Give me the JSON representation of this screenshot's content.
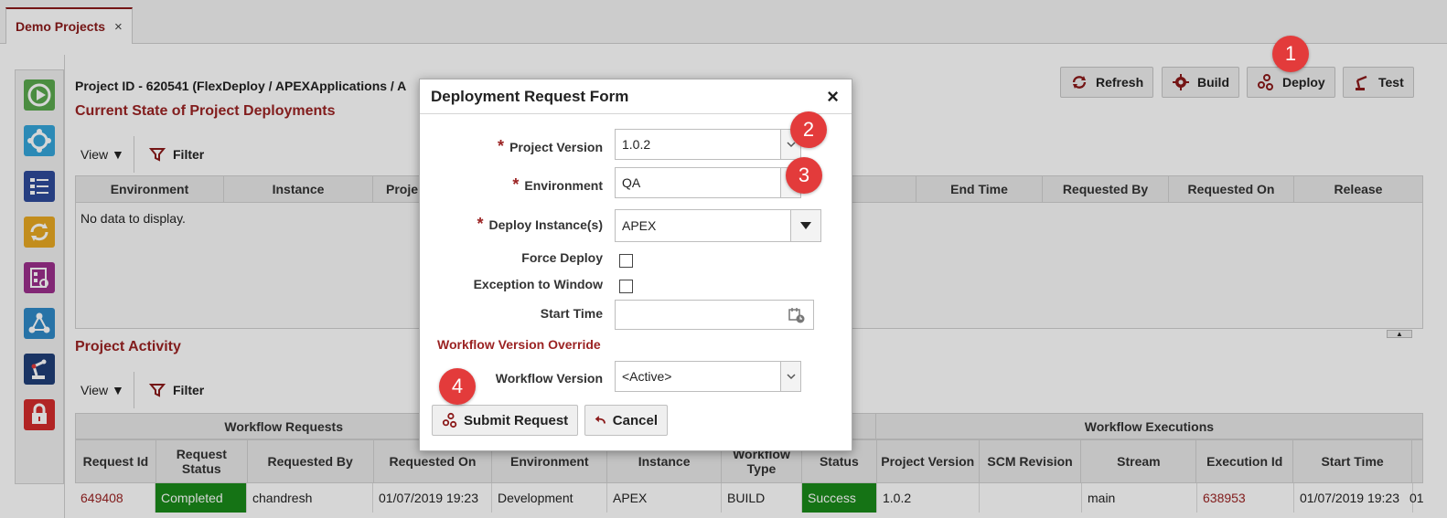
{
  "tab": {
    "title": "Demo Projects",
    "close": "×"
  },
  "project": {
    "id_text": "Project ID - 620541 (FlexDeploy / APEXApplications / A"
  },
  "sections": {
    "deployments": "Current State of Project Deployments",
    "activity": "Project Activity"
  },
  "toolbar": {
    "refresh": "Refresh",
    "build": "Build",
    "deploy": "Deploy",
    "test": "Test"
  },
  "viewbar": {
    "view": "View",
    "filter": "Filter"
  },
  "deploy_grid": {
    "columns": [
      "Environment",
      "Instance",
      "Proje",
      "",
      "End Time",
      "Requested By",
      "Requested On",
      "Release"
    ],
    "empty": "No data to display."
  },
  "activity_grid": {
    "group_left": "Workflow Requests",
    "group_right": "Workflow Executions",
    "columns": [
      "Request Id",
      "Request Status",
      "Requested By",
      "Requested On",
      "Environment",
      "Instance",
      "Workflow Type",
      "Status",
      "Project Version",
      "SCM Revision",
      "Stream",
      "Execution Id",
      "Start Time",
      ""
    ],
    "row": [
      "649408",
      "Completed",
      "chandresh",
      "01/07/2019 19:23",
      "Development",
      "APEX",
      "BUILD",
      "Success",
      "1.0.2",
      "",
      "main",
      "638953",
      "01/07/2019 19:23",
      "01"
    ]
  },
  "dialog": {
    "title": "Deployment Request Form",
    "close": "×",
    "project_version_label": "Project Version",
    "project_version_value": "1.0.2",
    "environment_label": "Environment",
    "environment_value": "QA",
    "deploy_instance_label": "Deploy Instance(s)",
    "deploy_instance_value": "APEX",
    "force_deploy_label": "Force Deploy",
    "exception_label": "Exception to Window",
    "start_time_label": "Start Time",
    "override_heading": "Workflow Version Override",
    "workflow_version_label": "Workflow Version",
    "workflow_version_value": "<Active>",
    "submit": "Submit Request",
    "cancel": "Cancel",
    "required_marker": "*"
  },
  "badges": {
    "b1": "1",
    "b2": "2",
    "b3": "3",
    "b4": "4"
  },
  "colors": {
    "accent": "#9b2323",
    "success": "#1a8a1a",
    "badge": "#e33b3b"
  }
}
